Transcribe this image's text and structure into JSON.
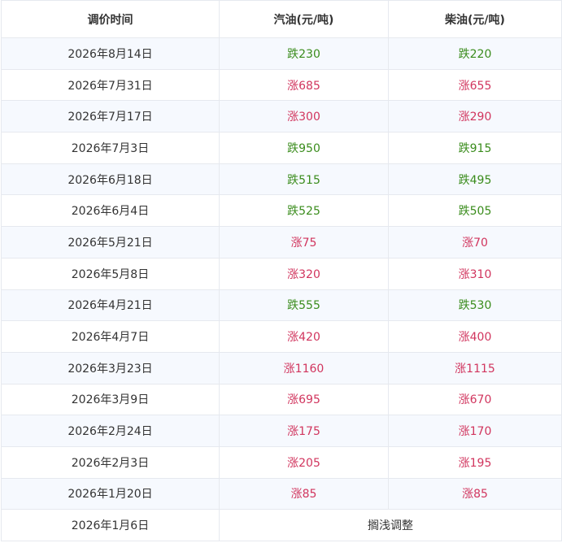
{
  "table": {
    "headers": [
      "调价时间",
      "汽油(元/吨)",
      "柴油(元/吨)"
    ],
    "colors": {
      "up": "#d1355e",
      "down": "#3a8c1c",
      "neutral": "#333333"
    },
    "rows": [
      {
        "date": "2026年8月14日",
        "gasoline": "跌230",
        "diesel": "跌220",
        "dir": "down"
      },
      {
        "date": "2026年7月31日",
        "gasoline": "涨685",
        "diesel": "涨655",
        "dir": "up"
      },
      {
        "date": "2026年7月17日",
        "gasoline": "涨300",
        "diesel": "涨290",
        "dir": "up"
      },
      {
        "date": "2026年7月3日",
        "gasoline": "跌950",
        "diesel": "跌915",
        "dir": "down"
      },
      {
        "date": "2026年6月18日",
        "gasoline": "跌515",
        "diesel": "跌495",
        "dir": "down"
      },
      {
        "date": "2026年6月4日",
        "gasoline": "跌525",
        "diesel": "跌505",
        "dir": "down"
      },
      {
        "date": "2026年5月21日",
        "gasoline": "涨75",
        "diesel": "涨70",
        "dir": "up"
      },
      {
        "date": "2026年5月8日",
        "gasoline": "涨320",
        "diesel": "涨310",
        "dir": "up"
      },
      {
        "date": "2026年4月21日",
        "gasoline": "跌555",
        "diesel": "跌530",
        "dir": "down"
      },
      {
        "date": "2026年4月7日",
        "gasoline": "涨420",
        "diesel": "涨400",
        "dir": "up"
      },
      {
        "date": "2026年3月23日",
        "gasoline": "涨1160",
        "diesel": "涨1115",
        "dir": "up"
      },
      {
        "date": "2026年3月9日",
        "gasoline": "涨695",
        "diesel": "涨670",
        "dir": "up"
      },
      {
        "date": "2026年2月24日",
        "gasoline": "涨175",
        "diesel": "涨170",
        "dir": "up"
      },
      {
        "date": "2026年2月3日",
        "gasoline": "涨205",
        "diesel": "涨195",
        "dir": "up"
      },
      {
        "date": "2026年1月20日",
        "gasoline": "涨85",
        "diesel": "涨85",
        "dir": "up"
      }
    ],
    "final_row": {
      "date": "2026年1月6日",
      "note": "搁浅调整"
    }
  }
}
